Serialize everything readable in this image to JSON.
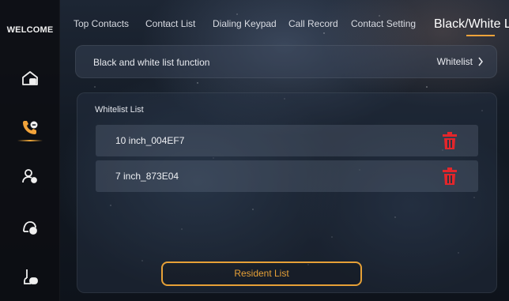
{
  "sidebar": {
    "title": "WELCOME",
    "items": [
      {
        "icon": "home-lock-icon"
      },
      {
        "icon": "phone-call-icon",
        "active": true
      },
      {
        "icon": "person-settings-icon"
      },
      {
        "icon": "person-info-icon"
      },
      {
        "icon": "hand-button-icon"
      }
    ]
  },
  "tabs": [
    {
      "label": "Top Contacts"
    },
    {
      "label": "Contact List"
    },
    {
      "label": "Dialing Keypad"
    },
    {
      "label": "Call Record"
    },
    {
      "label": "Contact Setting"
    },
    {
      "label": "Black/White L",
      "active": true
    }
  ],
  "function_bar": {
    "label": "Black and white list function",
    "value": "Whitelist"
  },
  "list": {
    "title": "Whitelist List",
    "items": [
      {
        "name": "10 inch_004EF7"
      },
      {
        "name": "7 inch_873E04"
      }
    ]
  },
  "resident_button": {
    "label": "Resident List"
  },
  "colors": {
    "accent": "#f2a33a",
    "delete": "#e3262b"
  }
}
